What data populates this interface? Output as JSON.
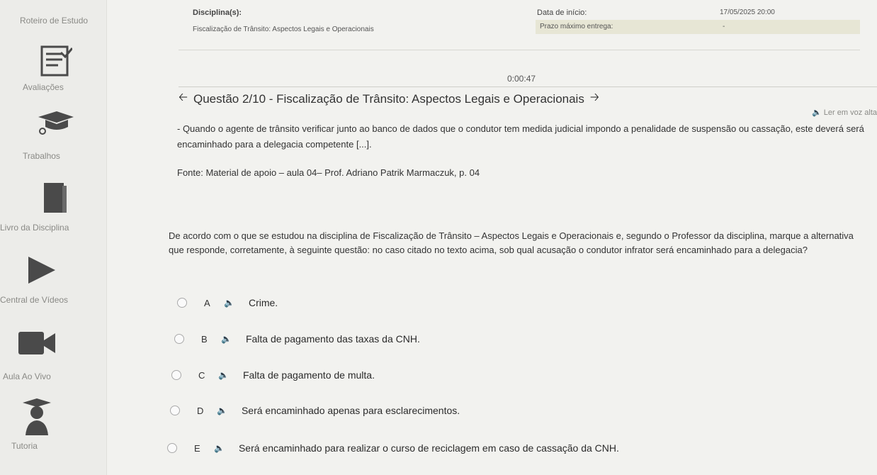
{
  "sidebar": {
    "items": [
      {
        "label": "Roteiro de Estudo",
        "icon": "study-plan-icon"
      },
      {
        "label": "Avaliações",
        "icon": "checklist-icon"
      },
      {
        "label": "Trabalhos",
        "icon": "graduation-cap-icon"
      },
      {
        "label": "Livro da Disciplina",
        "icon": "book-icon"
      },
      {
        "label": "Central de Vídeos",
        "icon": "play-icon"
      },
      {
        "label": "Aula Ao Vivo",
        "icon": "video-camera-icon"
      },
      {
        "label": "Tutoria",
        "icon": "tutor-icon"
      }
    ]
  },
  "header": {
    "discipline_label": "Disciplina(s):",
    "discipline_value": "Fiscalização de Trânsito: Aspectos Legais e Operacionais",
    "start_label": "Data de início:",
    "start_value": "17/05/2025 20:00",
    "deadline_label": "Prazo máximo entrega:",
    "deadline_value": "-"
  },
  "timer": "0:00:47",
  "question": {
    "title": "Questão 2/10 - Fiscalização de Trânsito: Aspectos Legais e Operacionais",
    "read_aloud": "Ler em voz alta",
    "statement": "- Quando o agente de trânsito verificar junto ao banco de dados que o condutor tem medida judicial impondo a penalidade de suspensão ou cassação, este deverá será encaminhado para a delegacia competente [...].",
    "source": "Fonte: Material de apoio – aula 04– Prof. Adriano Patrik Marmaczuk, p. 04",
    "prompt": "De acordo com o que se estudou na disciplina de Fiscalização de Trânsito – Aspectos Legais e Operacionais e, segundo o Professor da disciplina, marque a alternativa que responde, corretamente, à seguinte questão: no caso citado no texto acima, sob qual acusação o condutor infrator será encaminhado para a delegacia?",
    "options": [
      {
        "letter": "A",
        "text": "Crime."
      },
      {
        "letter": "B",
        "text": "Falta de pagamento das taxas da CNH."
      },
      {
        "letter": "C",
        "text": "Falta de pagamento de multa."
      },
      {
        "letter": "D",
        "text": "Será encaminhado apenas para esclarecimentos."
      },
      {
        "letter": "E",
        "text": "Será encaminhado para realizar o curso de reciclagem em caso de cassação da CNH."
      }
    ]
  },
  "colors": {
    "background": "#f2f2ef",
    "sidebar": "#ecece9",
    "deadline_highlight": "#e7e6d5",
    "icon": "#4a4a4a"
  }
}
